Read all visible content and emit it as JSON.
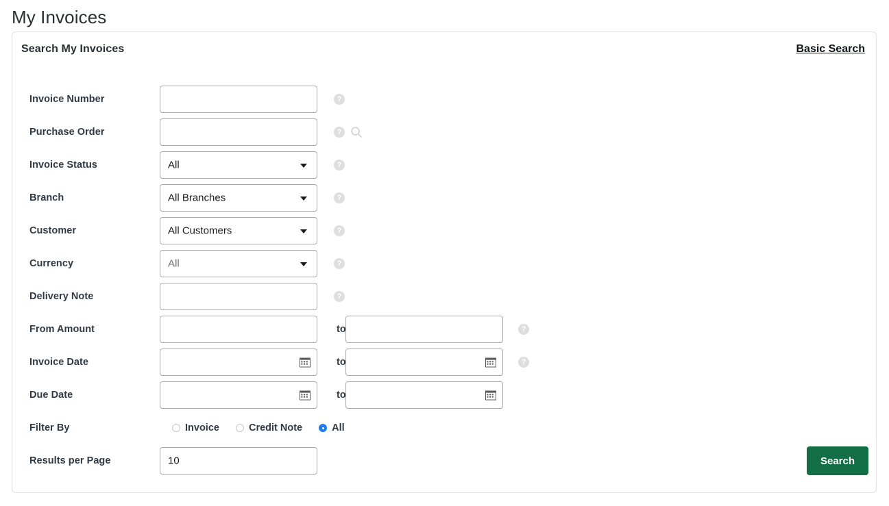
{
  "page": {
    "title": "My Invoices"
  },
  "panel": {
    "title": "Search My Invoices",
    "basic_search_label": "Basic Search"
  },
  "icons": {
    "help": "help-circle-icon",
    "magnifier": "search-icon",
    "calendar": "calendar-icon",
    "caret": "chevron-down-icon"
  },
  "colors": {
    "accent_button": "#126e45",
    "radio_selected": "#1d7ef2",
    "help_icon": "#dedede",
    "field_border": "#a9a9a9",
    "panel_border": "#e3e3e3"
  },
  "fields": {
    "invoice_number": {
      "label": "Invoice Number",
      "value": "",
      "placeholder": ""
    },
    "purchase_order": {
      "label": "Purchase Order",
      "value": "",
      "placeholder": ""
    },
    "invoice_status": {
      "label": "Invoice Status",
      "value": "All"
    },
    "branch": {
      "label": "Branch",
      "value": "All Branches"
    },
    "customer": {
      "label": "Customer",
      "value": "All Customers"
    },
    "currency": {
      "label": "Currency",
      "value": "All"
    },
    "delivery_note": {
      "label": "Delivery Note",
      "value": "",
      "placeholder": ""
    },
    "from_amount": {
      "label": "From Amount",
      "value_from": "",
      "value_to": "",
      "separator": "to"
    },
    "invoice_date": {
      "label": "Invoice Date",
      "value_from": "",
      "value_to": "",
      "separator": "to"
    },
    "due_date": {
      "label": "Due Date",
      "value_from": "",
      "value_to": "",
      "separator": "to"
    },
    "filter_by": {
      "label": "Filter By",
      "options": [
        {
          "label": "Invoice",
          "selected": false
        },
        {
          "label": "Credit Note",
          "selected": false
        },
        {
          "label": "All",
          "selected": true
        }
      ]
    },
    "results_per_page": {
      "label": "Results per Page",
      "value": "10"
    }
  },
  "actions": {
    "search_label": "Search"
  }
}
